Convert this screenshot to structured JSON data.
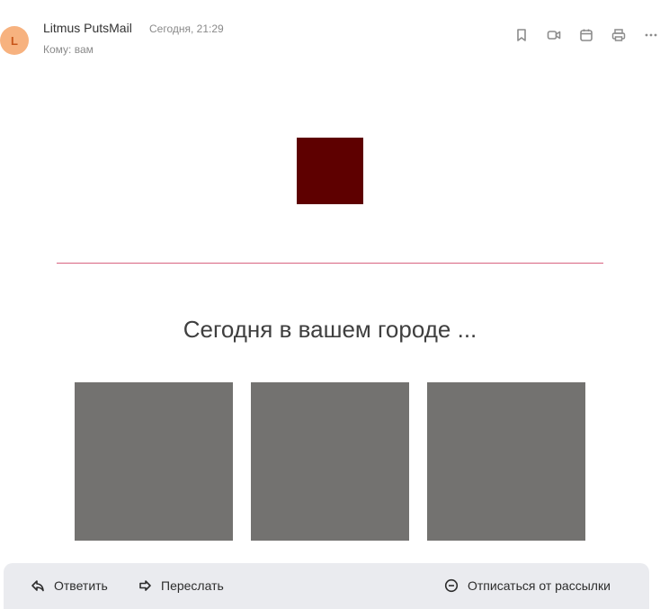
{
  "header": {
    "avatar_letter": "L",
    "sender": "Litmus PutsMail",
    "date": "Сегодня, 21:29",
    "recipient": "Кому: вам",
    "actions": [
      "bookmark-icon",
      "video-icon",
      "calendar-icon",
      "print-icon",
      "more-icon"
    ]
  },
  "body": {
    "headline": "Сегодня в вашем городе ...",
    "colors": {
      "logo": "#5e0000",
      "divider": "#d96380",
      "tile": "#737270"
    }
  },
  "footer": {
    "reply": "Ответить",
    "forward": "Переслать",
    "unsubscribe": "Отписаться от рассылки"
  }
}
